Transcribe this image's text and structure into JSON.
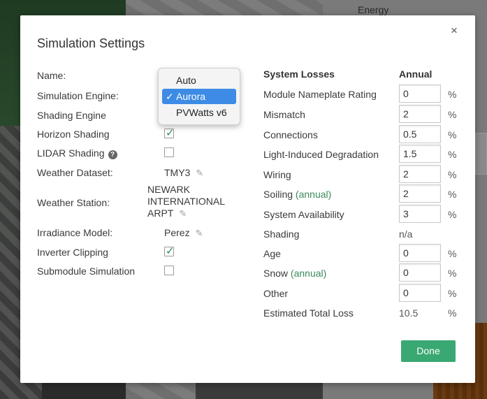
{
  "background": {
    "energy_label": "Energy"
  },
  "modal": {
    "title": "Simulation Settings",
    "close_glyph": "×",
    "done_label": "Done"
  },
  "settings": {
    "name_label": "Name:",
    "engine_label": "Simulation Engine:",
    "shading_engine_label": "Shading Engine",
    "horizon_label": "Horizon Shading",
    "horizon_checked": true,
    "lidar_label": "LIDAR Shading",
    "lidar_checked": false,
    "weather_dataset_label": "Weather Dataset:",
    "weather_dataset_value": "TMY3",
    "weather_station_label": "Weather Station:",
    "weather_station_lines": [
      "NEWARK",
      "INTERNATIONAL",
      "ARPT"
    ],
    "irradiance_label": "Irradiance Model:",
    "irradiance_value": "Perez",
    "inverter_label": "Inverter Clipping",
    "inverter_checked": true,
    "submodule_label": "Submodule Simulation",
    "submodule_checked": false
  },
  "engine_dropdown": {
    "options": [
      "Auto",
      "Aurora",
      "PVWatts v6"
    ],
    "selected": "Aurora",
    "check_glyph": "✓"
  },
  "losses": {
    "header": "System Losses",
    "column": "Annual",
    "unit": "%",
    "rows": [
      {
        "label": "Module Nameplate Rating",
        "value": "0"
      },
      {
        "label": "Mismatch",
        "value": "2"
      },
      {
        "label": "Connections",
        "value": "0.5"
      },
      {
        "label": "Light-Induced Degradation",
        "value": "1.5"
      },
      {
        "label": "Wiring",
        "value": "2"
      },
      {
        "label": "Soiling",
        "link": "(annual)",
        "value": "2"
      },
      {
        "label": "System Availability",
        "value": "3"
      },
      {
        "label": "Shading",
        "text": "n/a"
      },
      {
        "label": "Age",
        "value": "0"
      },
      {
        "label": "Snow",
        "link": "(annual)",
        "value": "0"
      },
      {
        "label": "Other",
        "value": "0"
      },
      {
        "label": "Estimated Total Loss",
        "text": "10.5"
      }
    ]
  },
  "colors": {
    "accent": "#3aa872",
    "link": "#3a8a5a",
    "select_highlight": "#3d8be4"
  }
}
